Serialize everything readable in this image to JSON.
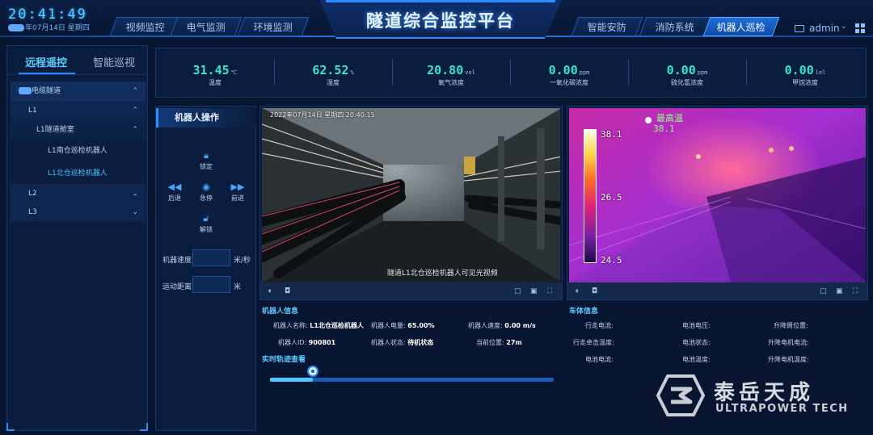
{
  "header": {
    "title": "隧道综合监控平台",
    "clock": "20:41:49",
    "date": "年07月14日 星期四",
    "left_tabs": [
      "视频监控",
      "电气监测",
      "环境监测"
    ],
    "right_tabs": [
      "智能安防",
      "消防系统",
      "机器人巡检"
    ],
    "active_tab": "机器人巡检",
    "user": "admin",
    "colors": {
      "accent": "#2d8cff",
      "active_tab": "#1e6fd9",
      "metric_value": "#38e6c7"
    }
  },
  "sidebar": {
    "tabs": [
      "远程遥控",
      "智能巡视"
    ],
    "active_tab": "远程遥控",
    "tree": [
      {
        "label": "电缆隧道",
        "expanded": true
      },
      {
        "label": "L1",
        "expanded": true
      },
      {
        "label": "L1隧道舱室",
        "expanded": true
      },
      {
        "label": "L1南仓巡检机器人"
      },
      {
        "label": "L1北仓巡检机器人",
        "selected": true
      },
      {
        "label": "L2",
        "expanded": false
      },
      {
        "label": "L3",
        "expanded": false
      }
    ]
  },
  "metrics": [
    {
      "value": "31.45",
      "unit": "℃",
      "label": "温度"
    },
    {
      "value": "62.52",
      "unit": "%",
      "label": "湿度"
    },
    {
      "value": "20.80",
      "unit": "vol",
      "label": "氧气浓度"
    },
    {
      "value": "0.00",
      "unit": "ppm",
      "label": "一氧化碳浓度"
    },
    {
      "value": "0.00",
      "unit": "ppm",
      "label": "硫化氢浓度"
    },
    {
      "value": "0.00",
      "unit": "lel",
      "label": "甲烷浓度"
    }
  ],
  "ops": {
    "title": "机器人操作",
    "lock": "锁定",
    "back": "后退",
    "stop": "急停",
    "forward": "前进",
    "unlock": "解锁",
    "speed_label": "机器速度",
    "speed_unit": "米/秒",
    "distance_label": "运动距离",
    "distance_unit": "米"
  },
  "camera": {
    "timestamp": "2022年07月14日 星期四 20:40:15",
    "caption": "隧道L1北仓巡检机器人可见光视频",
    "thermal_title": "最高温",
    "thermal_max": "38.1",
    "thermal_scale_top": "38.1",
    "thermal_scale_mid": "26.5",
    "thermal_scale_bottom": "24.5"
  },
  "robot_info": {
    "title": "机器人信息",
    "name_label": "机器人名称:",
    "name_value": "L1北仓巡检机器人",
    "power_label": "机器人电量:",
    "power_value": "65.00%",
    "speed_label": "机器人速度:",
    "speed_value": "0.00 m/s",
    "id_label": "机器人ID:",
    "id_value": "900801",
    "status_label": "机器人状态:",
    "status_value": "待机状态",
    "position_label": "当前位置:",
    "position_value": "27m"
  },
  "track": {
    "title": "实时轨迹查看",
    "progress": 0.15
  },
  "vehicle_info": {
    "title": "车体信息",
    "items": [
      "行走电流:",
      "电池电压:",
      "升降臂位置:",
      "行走卓击温度:",
      "电池状态:",
      "升降电机电流:",
      "电池电流:",
      "电池温度:",
      "升降电机温度:"
    ]
  },
  "logo": {
    "cn": "泰岳天成",
    "en": "ULTRAPOWER TECH"
  }
}
